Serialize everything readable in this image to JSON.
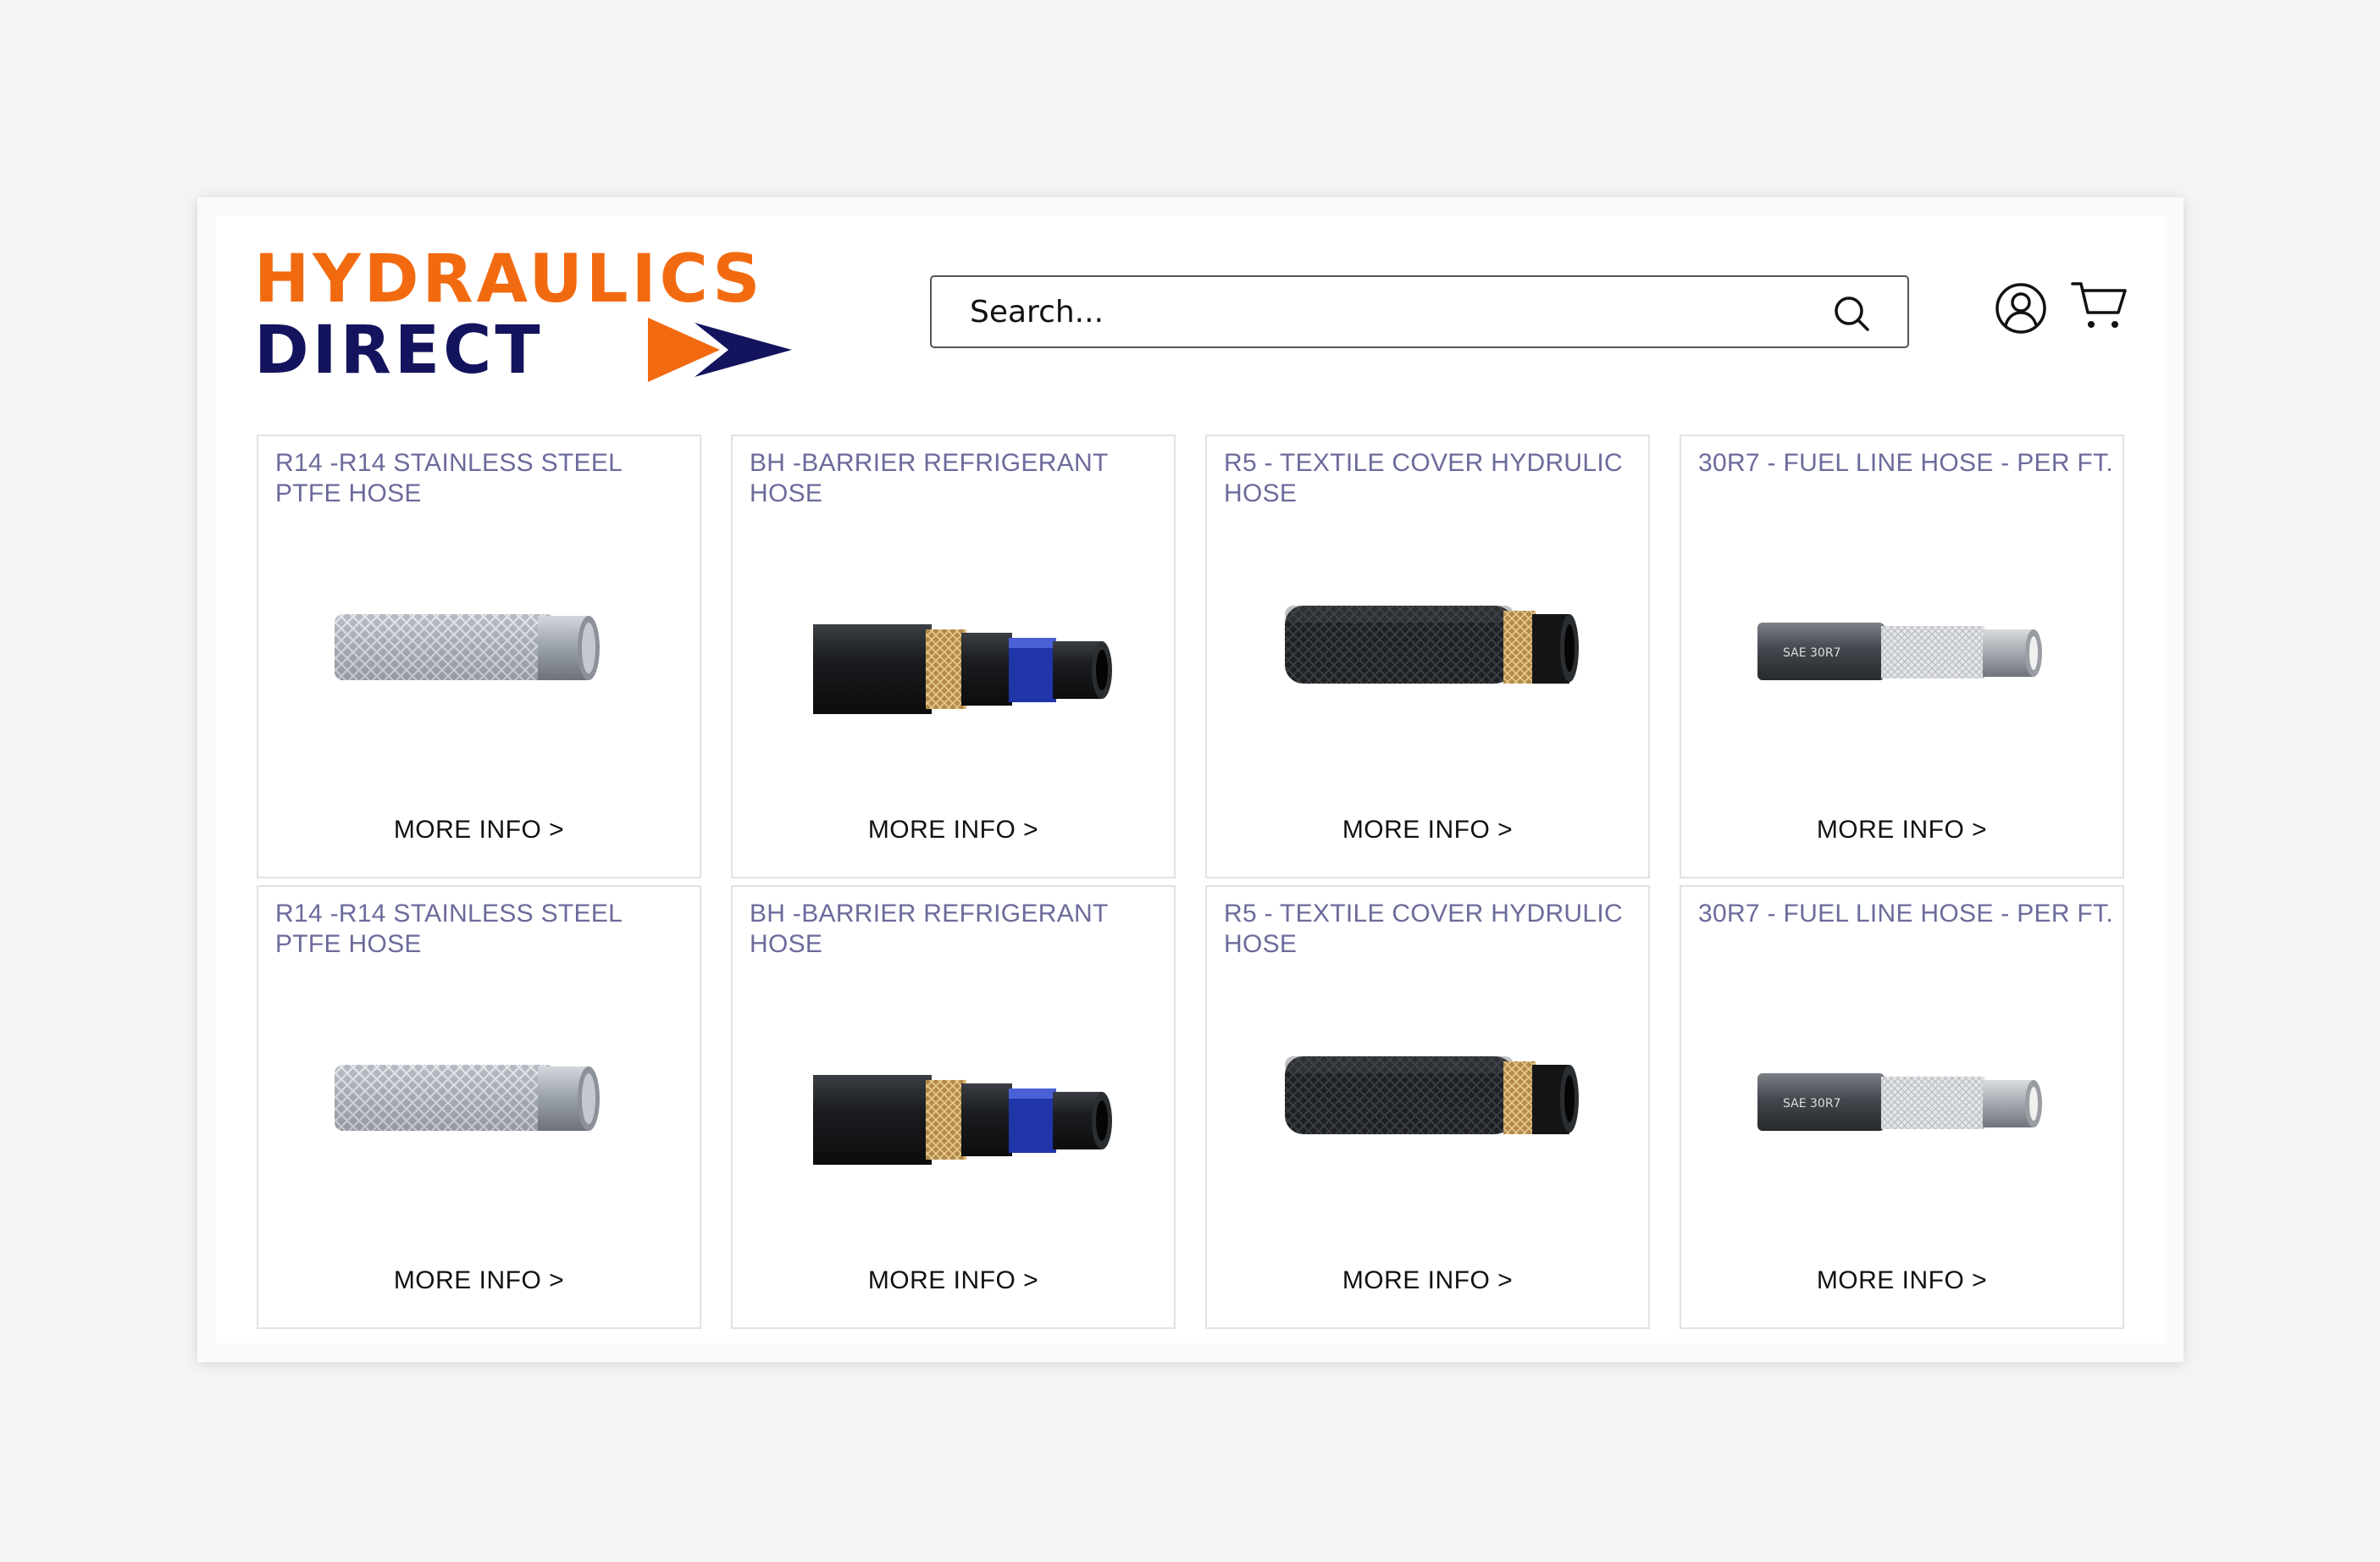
{
  "brand": {
    "line1": "Hydraulics",
    "line2": "Direct",
    "primary_color": "#f26a10",
    "secondary_color": "#13135e"
  },
  "search": {
    "placeholder": "Search...",
    "icon": "search-icon"
  },
  "header_icons": [
    "account-icon",
    "cart-icon"
  ],
  "products": [
    {
      "title": "R14 -R14 STAINLESS STEEL PTFE HOSE",
      "link": "MORE INFO >",
      "image": "stainless-braided-hose"
    },
    {
      "title": "BH -BARRIER REFRIGERANT HOSE",
      "link": "MORE INFO >",
      "image": "barrier-refrigerant-hose"
    },
    {
      "title": "R5 - TEXTILE COVER HYDRULIC HOSE",
      "link": "MORE INFO >",
      "image": "textile-cover-hose"
    },
    {
      "title": "30R7 - FUEL LINE HOSE - PER FT.",
      "link": "MORE INFO >",
      "image": "fuel-line-hose",
      "print": "SAE 30R7"
    },
    {
      "title": "R14 -R14 STAINLESS STEEL PTFE HOSE",
      "link": "MORE INFO >",
      "image": "stainless-braided-hose"
    },
    {
      "title": "BH -BARRIER REFRIGERANT HOSE",
      "link": "MORE INFO >",
      "image": "barrier-refrigerant-hose"
    },
    {
      "title": "R5 - TEXTILE COVER HYDRULIC HOSE",
      "link": "MORE INFO >",
      "image": "textile-cover-hose"
    },
    {
      "title": "30R7 - FUEL LINE HOSE - PER FT.",
      "link": "MORE INFO >",
      "image": "fuel-line-hose",
      "print": "SAE 30R7"
    }
  ]
}
